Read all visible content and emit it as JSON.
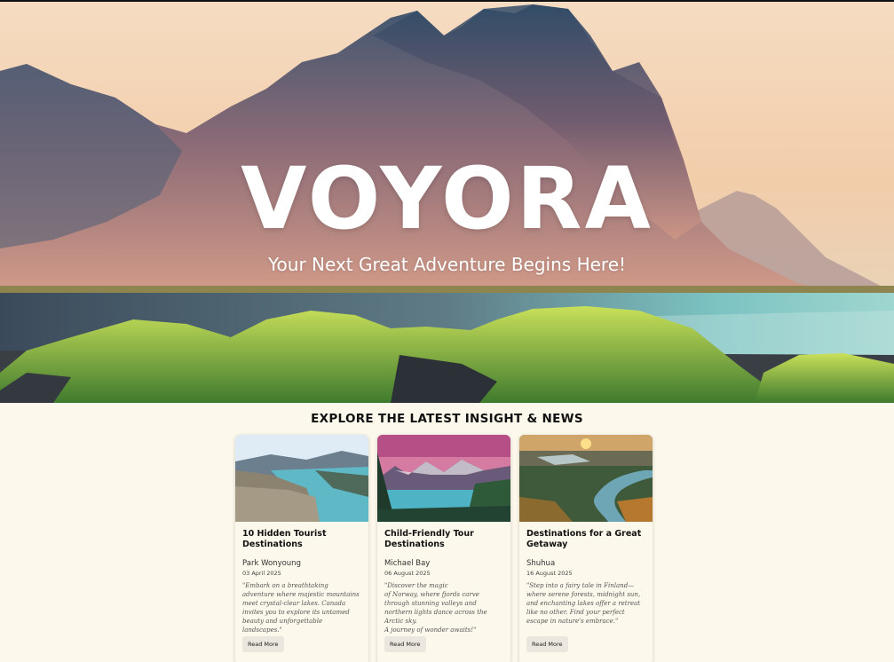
{
  "hero": {
    "title": "VOYORA",
    "subtitle": "Your Next Great Adventure Begins Here!"
  },
  "section": {
    "title": "EXPLORE THE LATEST INSIGHT & NEWS"
  },
  "cards": [
    {
      "title": "10 Hidden Tourist Destinations",
      "author": "Park Wonyoung",
      "date": "03 April 2025",
      "excerpt": "\"Embark on a breathtaking adventure where majestic mountains meet crystal-clear lakes. Canada invites you to explore its untamed beauty and unforgettable landscapes.\"",
      "button": "Read More"
    },
    {
      "title": "Child-Friendly Tour Destinations",
      "author": "Michael Bay",
      "date": "06 August 2025",
      "excerpt": "\"Discover the magic\nof Norway, where fjords carve through stunning valleys and northern lights dance across the Arctic sky.\nA journey of wonder awaits!\"",
      "button": "Read More"
    },
    {
      "title": "Destinations for a Great Getaway",
      "author": "Shuhua",
      "date": "16 August 2025",
      "excerpt": "\"Step into a fairy tale in Finland—where serene forests, midnight sun, and enchanting lakes offer a retreat like no other. Find your perfect escape in nature's embrace.\"",
      "button": "Read More"
    }
  ]
}
